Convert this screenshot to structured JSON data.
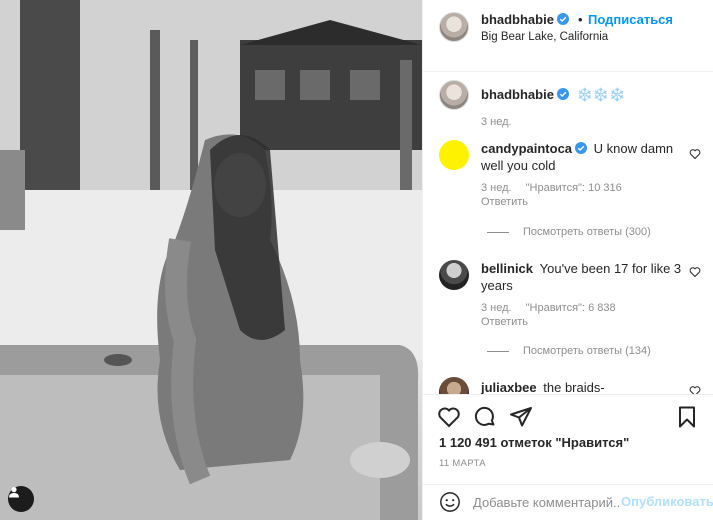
{
  "post": {
    "username": "bhadbhabie",
    "follow_label": "Подписаться",
    "dot": "•",
    "location": "Big Bear Lake, California"
  },
  "caption": {
    "username": "bhadbhabie",
    "text": "❄️❄️❄️",
    "time": "3 нед."
  },
  "comments": [
    {
      "username": "candypaintoca",
      "text": "U know damn well you cold",
      "time": "3 нед.",
      "likes": "\"Нравится\": 10 316",
      "reply": "Ответить",
      "view_replies": "Посмотреть ответы (300)"
    },
    {
      "username": "bellinick",
      "text": "You've been 17 for like 3 years",
      "time": "3 нед.",
      "likes": "\"Нравится\": 6 838",
      "reply": "Ответить",
      "view_replies": "Посмотреть ответы (134)"
    },
    {
      "username": "juliaxbee",
      "text": "the braids-"
    }
  ],
  "stats": {
    "likes": "1 120 491 отметок \"Нравится\"",
    "date": "11 МАРТА"
  },
  "add_comment": {
    "placeholder": "Добавьте комментарий...",
    "publish": "Опубликовать"
  },
  "colors": {
    "accent": "#0095f6",
    "publish_disabled": "#b2dffc",
    "verified": "#3897f0",
    "candy_avatar": "#fff200"
  },
  "icons": [
    "user-tag-icon",
    "verified-icon",
    "heart-icon",
    "comment-icon",
    "share-icon",
    "bookmark-icon",
    "emoji-icon"
  ]
}
